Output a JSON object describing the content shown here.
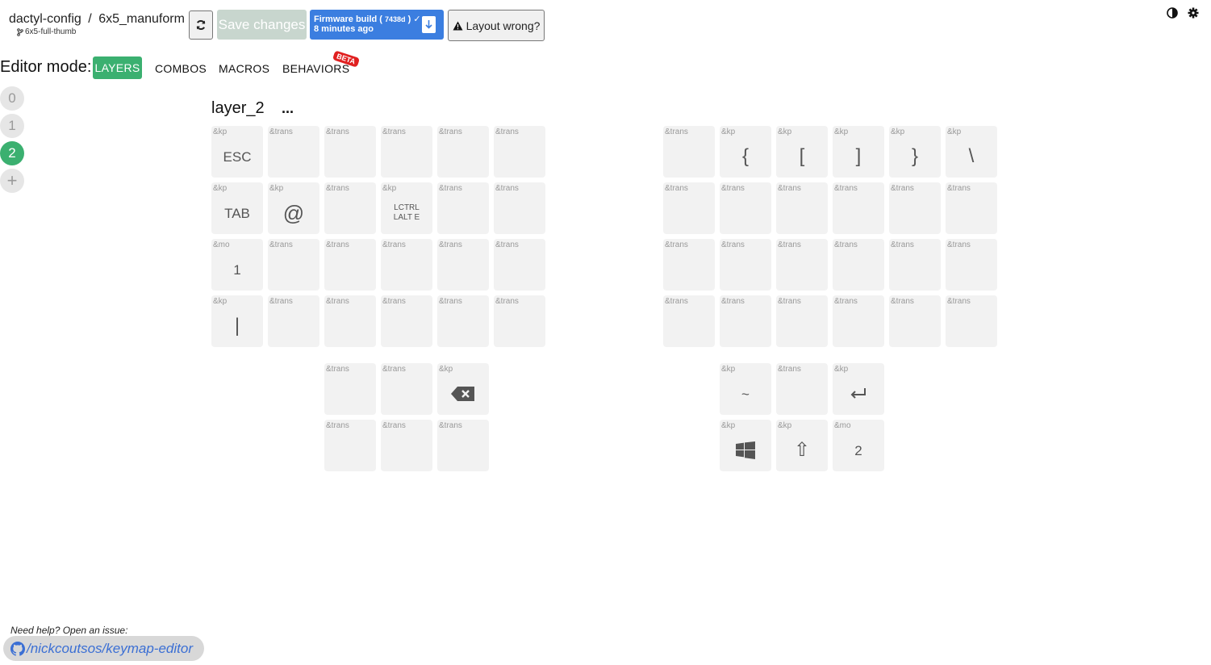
{
  "header": {
    "repo": "dactyl-config",
    "separator": "/",
    "keyboard": "6x5_manuform",
    "branch": "6x5-full-thumb",
    "save_label": "Save changes",
    "build_title": "Firmware build",
    "build_hash": "7438d",
    "build_time": "8 minutes ago",
    "layout_wrong_label": "Layout wrong?"
  },
  "editor": {
    "mode_label": "Editor mode:",
    "tabs": [
      {
        "label": "LAYERS",
        "active": true
      },
      {
        "label": "COMBOS",
        "active": false
      },
      {
        "label": "MACROS",
        "active": false
      },
      {
        "label": "BEHAVIORS",
        "active": false
      }
    ],
    "beta_badge": "BETA"
  },
  "layers": {
    "items": [
      "0",
      "1",
      "2"
    ],
    "active": "2",
    "add_label": "+",
    "current_name": "layer_2",
    "menu_label": "..."
  },
  "keys": [
    {
      "b": "&kp",
      "l": "ESC"
    },
    {
      "b": "&trans",
      "l": ""
    },
    {
      "b": "&trans",
      "l": ""
    },
    {
      "b": "&trans",
      "l": ""
    },
    {
      "b": "&trans",
      "l": ""
    },
    {
      "b": "&trans",
      "l": ""
    },
    {
      "b": "&trans",
      "l": ""
    },
    {
      "b": "&kp",
      "l": "{"
    },
    {
      "b": "&kp",
      "l": "["
    },
    {
      "b": "&kp",
      "l": "]"
    },
    {
      "b": "&kp",
      "l": "}"
    },
    {
      "b": "&kp",
      "l": "\\"
    },
    {
      "b": "&kp",
      "l": "TAB"
    },
    {
      "b": "&kp",
      "l": "@"
    },
    {
      "b": "&trans",
      "l": ""
    },
    {
      "b": "&kp",
      "l": "LCTRL LALT E"
    },
    {
      "b": "&trans",
      "l": ""
    },
    {
      "b": "&trans",
      "l": ""
    },
    {
      "b": "&trans",
      "l": ""
    },
    {
      "b": "&trans",
      "l": ""
    },
    {
      "b": "&trans",
      "l": ""
    },
    {
      "b": "&trans",
      "l": ""
    },
    {
      "b": "&trans",
      "l": ""
    },
    {
      "b": "&trans",
      "l": ""
    },
    {
      "b": "&mo",
      "l": "1"
    },
    {
      "b": "&trans",
      "l": ""
    },
    {
      "b": "&trans",
      "l": ""
    },
    {
      "b": "&trans",
      "l": ""
    },
    {
      "b": "&trans",
      "l": ""
    },
    {
      "b": "&trans",
      "l": ""
    },
    {
      "b": "&trans",
      "l": ""
    },
    {
      "b": "&trans",
      "l": ""
    },
    {
      "b": "&trans",
      "l": ""
    },
    {
      "b": "&trans",
      "l": ""
    },
    {
      "b": "&trans",
      "l": ""
    },
    {
      "b": "&trans",
      "l": ""
    },
    {
      "b": "&kp",
      "l": "|"
    },
    {
      "b": "&trans",
      "l": ""
    },
    {
      "b": "&trans",
      "l": ""
    },
    {
      "b": "&trans",
      "l": ""
    },
    {
      "b": "&trans",
      "l": ""
    },
    {
      "b": "&trans",
      "l": ""
    },
    {
      "b": "&trans",
      "l": ""
    },
    {
      "b": "&trans",
      "l": ""
    },
    {
      "b": "&trans",
      "l": ""
    },
    {
      "b": "&trans",
      "l": ""
    },
    {
      "b": "&trans",
      "l": ""
    },
    {
      "b": "&trans",
      "l": ""
    },
    {
      "b": "&trans",
      "l": ""
    },
    {
      "b": "&trans",
      "l": ""
    },
    {
      "b": "&kp",
      "l": "",
      "icon": "backspace-icon"
    },
    {
      "b": "&kp",
      "l": "~"
    },
    {
      "b": "&trans",
      "l": ""
    },
    {
      "b": "&kp",
      "l": "",
      "icon": "enter-icon"
    },
    {
      "b": "&trans",
      "l": ""
    },
    {
      "b": "&trans",
      "l": ""
    },
    {
      "b": "&trans",
      "l": ""
    },
    {
      "b": "&kp",
      "l": "",
      "icon": "windows-icon"
    },
    {
      "b": "&kp",
      "l": "⇧"
    },
    {
      "b": "&mo",
      "l": "2"
    }
  ],
  "footer": {
    "help_text": "Need help? Open an issue:",
    "github_link": "/nickcoutsos/keymap-editor"
  },
  "colors": {
    "accent_green": "#3bb070",
    "build_blue": "#3b7ee0",
    "beta_red": "#e02020",
    "key_bg": "#f2f2f2",
    "link_blue": "#3b6fd4"
  }
}
